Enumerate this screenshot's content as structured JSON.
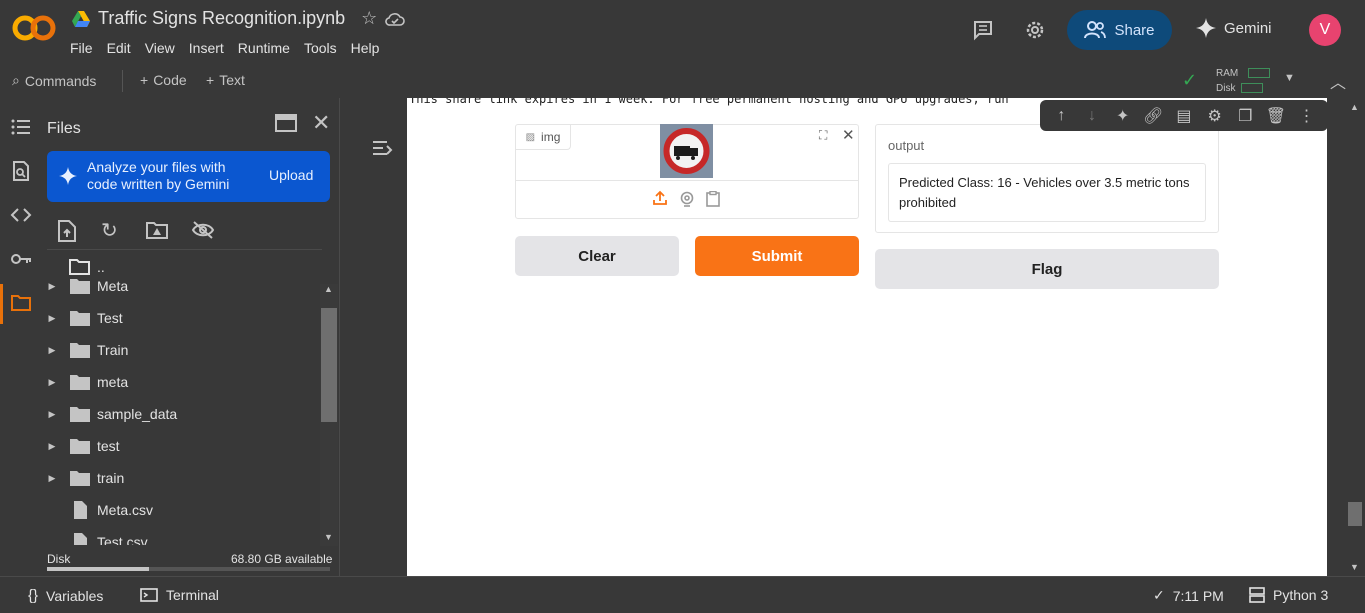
{
  "header": {
    "notebook_title": "Traffic Signs Recognition.ipynb",
    "logo_text": "CO",
    "menu": [
      "File",
      "Edit",
      "View",
      "Insert",
      "Runtime",
      "Tools",
      "Help"
    ],
    "share_label": "Share",
    "gemini_label": "Gemini",
    "avatar_letter": "V"
  },
  "toolbar": {
    "commands_label": "Commands",
    "code_label": "Code",
    "text_label": "Text",
    "ram_label": "RAM",
    "disk_label": "Disk"
  },
  "files_panel": {
    "title": "Files",
    "gemini_banner_text": "Analyze your files with code written by Gemini",
    "upload_label": "Upload",
    "items": [
      {
        "name": "..",
        "type": "parent"
      },
      {
        "name": "Meta",
        "type": "folder"
      },
      {
        "name": "Test",
        "type": "folder"
      },
      {
        "name": "Train",
        "type": "folder"
      },
      {
        "name": "meta",
        "type": "folder"
      },
      {
        "name": "sample_data",
        "type": "folder"
      },
      {
        "name": "test",
        "type": "folder"
      },
      {
        "name": "train",
        "type": "folder"
      },
      {
        "name": "Meta.csv",
        "type": "file"
      },
      {
        "name": "Test.csv",
        "type": "file"
      }
    ],
    "disk_label": "Disk",
    "disk_available": "68.80 GB available"
  },
  "output_cell": {
    "share_link_text": "This share link expires in 1 week. For free permanent hosting and GPU upgrades, run",
    "image_input_label": "img",
    "output_label": "output",
    "output_value": "Predicted Class: 16 - Vehicles over 3.5 metric tons prohibited",
    "clear_label": "Clear",
    "submit_label": "Submit",
    "flag_label": "Flag"
  },
  "statusbar": {
    "variables_label": "Variables",
    "terminal_label": "Terminal",
    "time": "7:11 PM",
    "runtime": "Python 3"
  },
  "colors": {
    "accent_orange": "#f97316",
    "share_bg": "#0e4a7a",
    "gemini_banner": "#0b57d0",
    "avatar": "#e8436f"
  }
}
